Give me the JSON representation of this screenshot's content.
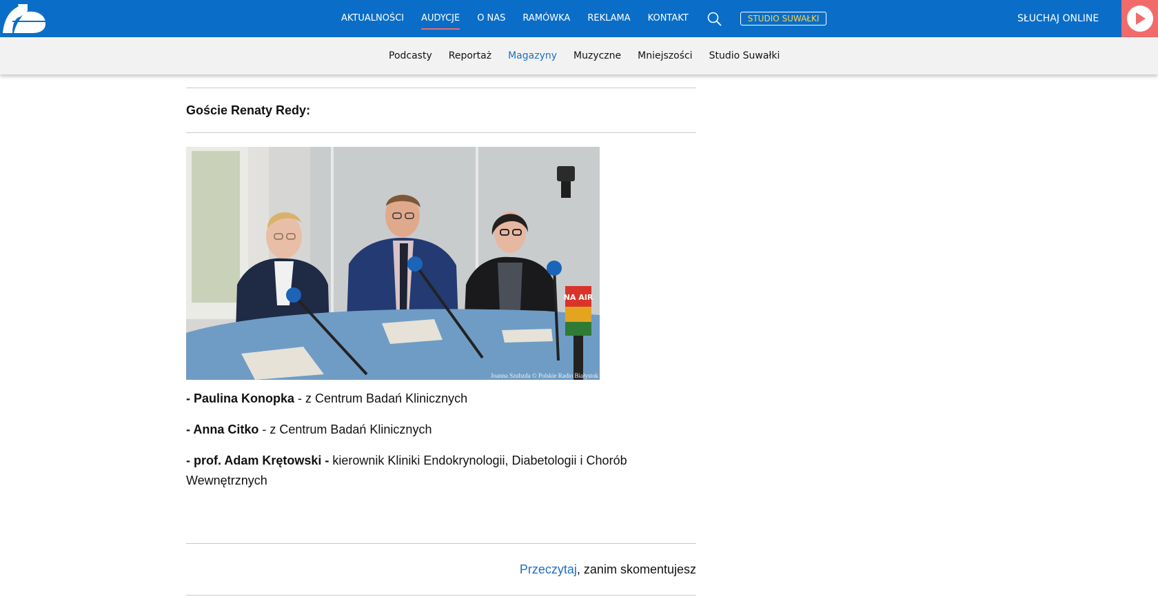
{
  "header": {
    "logo_name": "polskie-radio-bialystok-logo",
    "nav": [
      {
        "label": "AKTUALNOŚCI",
        "active": false
      },
      {
        "label": "AUDYCJE",
        "active": true
      },
      {
        "label": "O NAS",
        "active": false
      },
      {
        "label": "RAMÓWKA",
        "active": false
      },
      {
        "label": "REKLAMA",
        "active": false
      },
      {
        "label": "KONTAKT",
        "active": false
      }
    ],
    "search_icon": "search-icon",
    "studio_button": "STUDIO SUWAŁKI",
    "listen_label": "SŁUCHAJ ONLINE",
    "play_icon": "play-icon",
    "colors": {
      "bar": "#0a6ec8",
      "accent": "#f26b6b",
      "studio_text": "#ffd24a"
    }
  },
  "subnav": {
    "items": [
      {
        "label": "Podcasty",
        "active": false
      },
      {
        "label": "Reportaż",
        "active": false
      },
      {
        "label": "Magazyny",
        "active": true
      },
      {
        "label": "Muzyczne",
        "active": false
      },
      {
        "label": "Mniejszości",
        "active": false
      },
      {
        "label": "Studio Suwałki",
        "active": false
      }
    ]
  },
  "article": {
    "guests_heading": "Goście Renaty Redy:",
    "photo_credit": "Joanna Szubzda © Polskie Radio Białystok",
    "photo_sign": "NA AIR",
    "guests": [
      {
        "prefix": "- ",
        "name": "Paulina Konopka",
        "sep": " - ",
        "role": "z Centrum Badań Klinicznych"
      },
      {
        "prefix": "- ",
        "name": "Anna Citko",
        "sep": " - ",
        "role": "z Centrum Badań Klinicznych"
      },
      {
        "prefix": "- ",
        "name": "prof. Adam Krętowski",
        "sep": " - ",
        "role": "kierownik Kliniki Endokrynologii, Diabetologii i Chorób Wewnętrznych"
      }
    ],
    "comment": {
      "link": "Przeczytaj",
      "rest": ", zanim skomentujesz"
    }
  }
}
